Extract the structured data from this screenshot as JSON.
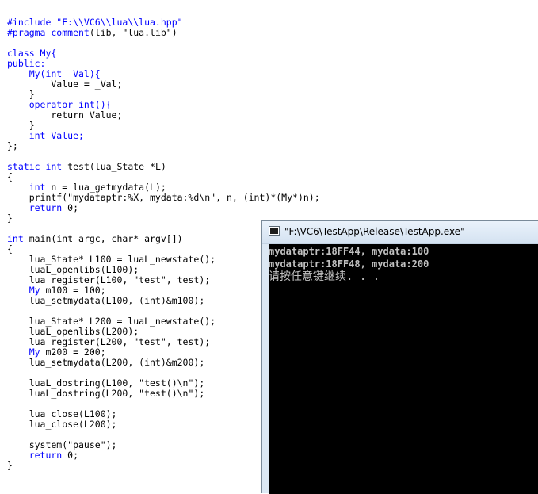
{
  "editor": {
    "lines": [
      [
        {
          "t": "#include \"F:\\\\VC6\\\\lua\\\\lua.hpp\"",
          "c": "pp"
        }
      ],
      [
        {
          "t": "#pragma comment",
          "c": "pp"
        },
        {
          "t": "(lib, \"lua.lib\")",
          "c": "plain"
        }
      ],
      [],
      [
        {
          "t": "class My{",
          "c": "kw"
        }
      ],
      [
        {
          "t": "public:",
          "c": "kw"
        }
      ],
      [
        {
          "t": "    My(int _Val){",
          "c": "kw"
        }
      ],
      [
        {
          "t": "        Value = _Val;",
          "c": "plain"
        }
      ],
      [
        {
          "t": "    }",
          "c": "plain"
        }
      ],
      [
        {
          "t": "    operator int(){",
          "c": "kw"
        }
      ],
      [
        {
          "t": "        return Value;",
          "c": "plain"
        }
      ],
      [
        {
          "t": "    }",
          "c": "plain"
        }
      ],
      [
        {
          "t": "    int Value;",
          "c": "kw"
        }
      ],
      [
        {
          "t": "};",
          "c": "plain"
        }
      ],
      [],
      [
        {
          "t": "static int ",
          "c": "kw"
        },
        {
          "t": "test(lua_State *L)",
          "c": "plain"
        }
      ],
      [
        {
          "t": "{",
          "c": "plain"
        }
      ],
      [
        {
          "t": "    int ",
          "c": "kw"
        },
        {
          "t": "n = lua_getmydata(L);",
          "c": "plain"
        }
      ],
      [
        {
          "t": "    printf(\"mydataptr:%X, mydata:%d\\n\", n, (int)*(My*)n);",
          "c": "plain"
        }
      ],
      [
        {
          "t": "    return ",
          "c": "kw"
        },
        {
          "t": "0;",
          "c": "plain"
        }
      ],
      [
        {
          "t": "}",
          "c": "plain"
        }
      ],
      [],
      [
        {
          "t": "int ",
          "c": "kw"
        },
        {
          "t": "main(int argc, char* argv[])",
          "c": "plain"
        }
      ],
      [
        {
          "t": "{",
          "c": "plain"
        }
      ],
      [
        {
          "t": "    lua_State* L100 = luaL_newstate();",
          "c": "plain"
        }
      ],
      [
        {
          "t": "    luaL_openlibs(L100);",
          "c": "plain"
        }
      ],
      [
        {
          "t": "    lua_register(L100, \"test\", test);",
          "c": "plain"
        }
      ],
      [
        {
          "t": "    My ",
          "c": "kw"
        },
        {
          "t": "m100 = 100;",
          "c": "plain"
        }
      ],
      [
        {
          "t": "    lua_setmydata(L100, (int)&m100);",
          "c": "plain"
        }
      ],
      [],
      [
        {
          "t": "    lua_State* L200 = luaL_newstate();",
          "c": "plain"
        }
      ],
      [
        {
          "t": "    luaL_openlibs(L200);",
          "c": "plain"
        }
      ],
      [
        {
          "t": "    lua_register(L200, \"test\", test);",
          "c": "plain"
        }
      ],
      [
        {
          "t": "    My ",
          "c": "kw"
        },
        {
          "t": "m200 = 200;",
          "c": "plain"
        }
      ],
      [
        {
          "t": "    lua_setmydata(L200, (int)&m200);",
          "c": "plain"
        }
      ],
      [],
      [
        {
          "t": "    luaL_dostring(L100, \"test()\\n\");",
          "c": "plain"
        }
      ],
      [
        {
          "t": "    luaL_dostring(L200, \"test()\\n\");",
          "c": "plain"
        }
      ],
      [],
      [
        {
          "t": "    lua_close(L100);",
          "c": "plain"
        }
      ],
      [
        {
          "t": "    lua_close(L200);",
          "c": "plain"
        }
      ],
      [],
      [
        {
          "t": "    system(\"pause\");",
          "c": "plain"
        }
      ],
      [
        {
          "t": "    return ",
          "c": "kw"
        },
        {
          "t": "0;",
          "c": "plain"
        }
      ],
      [
        {
          "t": "}",
          "c": "plain"
        }
      ]
    ]
  },
  "console": {
    "title": "\"F:\\VC6\\TestApp\\Release\\TestApp.exe\"",
    "icon": "console-window-icon",
    "output_lines": [
      "mydataptr:18FF44, mydata:100",
      "mydataptr:18FF48, mydata:200"
    ],
    "prompt": "请按任意键继续. . ."
  },
  "colors": {
    "keyword": "#0000ff",
    "text": "#000000",
    "console_bg": "#000000",
    "console_text": "#c0c0c0"
  }
}
